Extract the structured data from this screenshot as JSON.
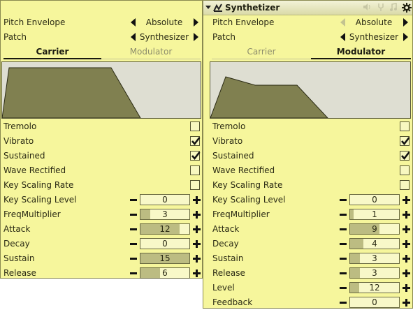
{
  "left": {
    "pitch_envelope": {
      "label": "Pitch Envelope",
      "value": "Absolute"
    },
    "patch": {
      "label": "Patch",
      "value": "Synthesizer"
    },
    "tabs": [
      {
        "label": "Carrier",
        "active": true
      },
      {
        "label": "Modulator",
        "active": false
      }
    ],
    "checkboxes": [
      {
        "label": "Tremolo",
        "checked": false
      },
      {
        "label": "Vibrato",
        "checked": true
      },
      {
        "label": "Sustained",
        "checked": true
      },
      {
        "label": "Wave Rectified",
        "checked": false
      },
      {
        "label": "Key Scaling Rate",
        "checked": false
      }
    ],
    "steppers": [
      {
        "label": "Key Scaling Level",
        "value": "0",
        "fraction": 0.0
      },
      {
        "label": "FreqMultiplier",
        "value": "3",
        "fraction": 0.2
      },
      {
        "label": "Attack",
        "value": "12",
        "fraction": 0.8
      },
      {
        "label": "Decay",
        "value": "0",
        "fraction": 0.0
      },
      {
        "label": "Sustain",
        "value": "15",
        "fraction": 1.0
      },
      {
        "label": "Release",
        "value": "6",
        "fraction": 0.4
      }
    ]
  },
  "right": {
    "title": "Synthetizer",
    "title_icons": [
      "speaker-icon",
      "tuning-fork-icon",
      "music-notes-icon"
    ],
    "pitch_envelope": {
      "label": "Pitch Envelope",
      "value": "Absolute"
    },
    "patch": {
      "label": "Patch",
      "value": "Synthesizer"
    },
    "tabs": [
      {
        "label": "Carrier",
        "active": false
      },
      {
        "label": "Modulator",
        "active": true
      }
    ],
    "checkboxes": [
      {
        "label": "Tremolo",
        "checked": false
      },
      {
        "label": "Vibrato",
        "checked": true
      },
      {
        "label": "Sustained",
        "checked": true
      },
      {
        "label": "Wave Rectified",
        "checked": false
      },
      {
        "label": "Key Scaling Rate",
        "checked": false
      }
    ],
    "steppers": [
      {
        "label": "Key Scaling Level",
        "value": "0",
        "fraction": 0.0
      },
      {
        "label": "FreqMultiplier",
        "value": "1",
        "fraction": 0.067
      },
      {
        "label": "Attack",
        "value": "9",
        "fraction": 0.6
      },
      {
        "label": "Decay",
        "value": "4",
        "fraction": 0.267
      },
      {
        "label": "Sustain",
        "value": "3",
        "fraction": 0.2
      },
      {
        "label": "Release",
        "value": "3",
        "fraction": 0.2
      },
      {
        "label": "Level",
        "value": "12",
        "fraction": 0.19
      },
      {
        "label": "Feedback",
        "value": "0",
        "fraction": 0.0
      }
    ]
  },
  "colors": {
    "panel_bg": "#f6f69c",
    "envelope_fill": "#808050",
    "envelope_bg": "#deded2",
    "slider_fill": "#bcbc82"
  }
}
